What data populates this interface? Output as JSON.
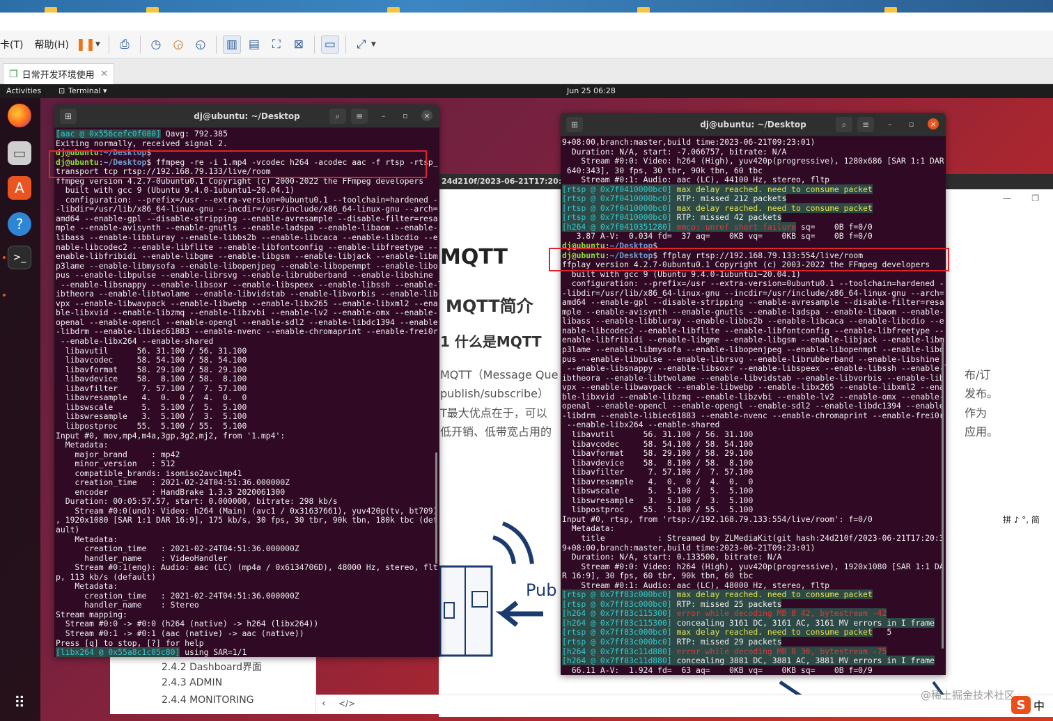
{
  "host": {
    "menu": [
      "卡(T)",
      "帮助(H)"
    ],
    "toolbar_icons": [
      "pause-icon",
      "send-keys-icon",
      "snapshot-icon",
      "revert-icon",
      "manage-snapshots-icon",
      "sidebar-icon",
      "thumbnail-icon",
      "fullscreen-icon",
      "unity-icon",
      "console-icon",
      "stretch-icon"
    ],
    "tab_label": "日常开发环境使用",
    "tab_close": "✕"
  },
  "gnome": {
    "activities": "Activities",
    "app": "Terminal ▾",
    "clock": "Jun 25  06:28"
  },
  "doc": {
    "bar_text": "24d210f/2023-06-21T17:20:39+08:",
    "h1": "MQTT",
    "h2": "MQTT简介",
    "h3": "1 什么是MQTT",
    "p1": "MQTT（Message Que",
    "p2": "publish/subscribe）",
    "p3": "T最大优点在于，可以",
    "p4": "低开销、低带宽占用的",
    "r1": "布/订",
    "r2": "发布。",
    "r3": "作为",
    "r4": "应用。",
    "diagram_label": "Pub",
    "toc": [
      "2.4.2 Dashboard界面",
      "2.4.3 ADMIN",
      "2.4.4 MONITORING"
    ]
  },
  "term_left": {
    "title": "dj@ubuntu: ~/Desktop",
    "lines": [
      [
        {
          "t": "[aac @ 0x556cefc0f080]",
          "c": "cy hl"
        },
        {
          "t": " Qavg: 792.385"
        }
      ],
      [
        {
          "t": "Exiting normally, received signal 2."
        }
      ],
      [
        {
          "t": "dj@ubuntu",
          "c": "gr"
        },
        {
          "t": ":"
        },
        {
          "t": "~/Desktop",
          "c": "bl"
        },
        {
          "t": "$"
        }
      ],
      [
        {
          "t": "dj@ubuntu",
          "c": "gr"
        },
        {
          "t": ":"
        },
        {
          "t": "~/Desktop",
          "c": "bl"
        },
        {
          "t": "$ ffmpeg -re -i 1.mp4 -vcodec h264 -acodec aac -f rtsp -rtsp_"
        }
      ],
      [
        {
          "t": "transport tcp rtsp://192.168.79.133/live/room"
        }
      ],
      [
        {
          "t": "ffmpeg version 4.2.7-0ubuntu0.1 Copyright (c) 2000-2022 the FFmpeg developers"
        }
      ],
      [
        {
          "t": "  built with gcc 9 (Ubuntu 9.4.0-1ubuntu1~20.04.1)"
        }
      ],
      [
        {
          "t": "  configuration: --prefix=/usr --extra-version=0ubuntu0.1 --toolchain=hardened -"
        }
      ],
      [
        {
          "t": "-libdir=/usr/lib/x86_64-linux-gnu --incdir=/usr/include/x86_64-linux-gnu --arch="
        }
      ],
      [
        {
          "t": "amd64 --enable-gpl --disable-stripping --enable-avresample --disable-filter=resa"
        }
      ],
      [
        {
          "t": "mple --enable-avisynth --enable-gnutls --enable-ladspa --enable-libaom --enable-"
        }
      ],
      [
        {
          "t": "libass --enable-libbluray --enable-libbs2b --enable-libcaca --enable-libcdio --e"
        }
      ],
      [
        {
          "t": "nable-libcodec2 --enable-libflite --enable-libfontconfig --enable-libfreetype --"
        }
      ],
      [
        {
          "t": "enable-libfribidi --enable-libgme --enable-libgsm --enable-libjack --enable-libm"
        }
      ],
      [
        {
          "t": "p3lame --enable-libmysofa --enable-libopenjpeg --enable-libopenmpt --enable-libo"
        }
      ],
      [
        {
          "t": "pus --enable-libpulse --enable-librsvg --enable-librubberband --enable-libshine"
        }
      ],
      [
        {
          "t": " --enable-libsnappy --enable-libsoxr --enable-libspeex --enable-libssh --enable-l"
        }
      ],
      [
        {
          "t": "ibtheora --enable-libtwolame --enable-libvidstab --enable-libvorbis --enable-lib"
        }
      ],
      [
        {
          "t": "vpx --enable-libwavpack --enable-libwebp --enable-libx265 --enable-libxml2 --ena"
        }
      ],
      [
        {
          "t": "ble-libxvid --enable-libzmq --enable-libzvbi --enable-lv2 --enable-omx --enable-"
        }
      ],
      [
        {
          "t": "openal --enable-opencl --enable-opengl --enable-sdl2 --enable-libdc1394 --enable"
        }
      ],
      [
        {
          "t": "-libdrm --enable-libiec61883 --enable-nvenc --enable-chromaprint --enable-frei0r"
        }
      ],
      [
        {
          "t": " --enable-libx264 --enable-shared"
        }
      ],
      [
        {
          "t": "  libavutil      56. 31.100 / 56. 31.100"
        }
      ],
      [
        {
          "t": "  libavcodec     58. 54.100 / 58. 54.100"
        }
      ],
      [
        {
          "t": "  libavformat    58. 29.100 / 58. 29.100"
        }
      ],
      [
        {
          "t": "  libavdevice    58.  8.100 / 58.  8.100"
        }
      ],
      [
        {
          "t": "  libavfilter     7. 57.100 /  7. 57.100"
        }
      ],
      [
        {
          "t": "  libavresample   4.  0.  0 /  4.  0.  0"
        }
      ],
      [
        {
          "t": "  libswscale      5.  5.100 /  5.  5.100"
        }
      ],
      [
        {
          "t": "  libswresample   3.  5.100 /  3.  5.100"
        }
      ],
      [
        {
          "t": "  libpostproc    55.  5.100 / 55.  5.100"
        }
      ],
      [
        {
          "t": "Input #0, mov,mp4,m4a,3gp,3g2,mj2, from '1.mp4':"
        }
      ],
      [
        {
          "t": "  Metadata:"
        }
      ],
      [
        {
          "t": "    major_brand     : mp42"
        }
      ],
      [
        {
          "t": "    minor_version   : 512"
        }
      ],
      [
        {
          "t": "    compatible_brands: isomiso2avc1mp41"
        }
      ],
      [
        {
          "t": "    creation_time   : 2021-02-24T04:51:36.000000Z"
        }
      ],
      [
        {
          "t": "    encoder         : HandBrake 1.3.3 2020061300"
        }
      ],
      [
        {
          "t": "  Duration: 00:05:57.57, start: 0.000000, bitrate: 298 kb/s"
        }
      ],
      [
        {
          "t": "    Stream #0:0(und): Video: h264 (Main) (avc1 / 0x31637661), yuv420p(tv, bt709)"
        }
      ],
      [
        {
          "t": ", 1920x1080 [SAR 1:1 DAR 16:9], 175 kb/s, 30 fps, 30 tbr, 90k tbn, 180k tbc (def"
        }
      ],
      [
        {
          "t": "ault)"
        }
      ],
      [
        {
          "t": "    Metadata:"
        }
      ],
      [
        {
          "t": "      creation_time   : 2021-02-24T04:51:36.000000Z"
        }
      ],
      [
        {
          "t": "      handler_name    : VideoHandler"
        }
      ],
      [
        {
          "t": "    Stream #0:1(eng): Audio: aac (LC) (mp4a / 0x6134706D), 48000 Hz, stereo, flt"
        }
      ],
      [
        {
          "t": "p, 113 kb/s (default)"
        }
      ],
      [
        {
          "t": "    Metadata:"
        }
      ],
      [
        {
          "t": "      creation_time   : 2021-02-24T04:51:36.000000Z"
        }
      ],
      [
        {
          "t": "      handler_name    : Stereo"
        }
      ],
      [
        {
          "t": "Stream mapping:"
        }
      ],
      [
        {
          "t": "  Stream #0:0 -> #0:0 (h264 (native) -> h264 (libx264))"
        }
      ],
      [
        {
          "t": "  Stream #0:1 -> #0:1 (aac (native) -> aac (native))"
        }
      ],
      [
        {
          "t": "Press [q] to stop, [?] for help"
        }
      ],
      [
        {
          "t": "[libx264 @ 0x55a8c1c05c80]",
          "c": "cy hl"
        },
        {
          "t": " using SAR=1/1"
        }
      ]
    ]
  },
  "term_right": {
    "title": "dj@ubuntu: ~/Desktop",
    "lines": [
      [
        {
          "t": "9+08:00,branch:master,build time:2023-06-21T09:23:01)"
        }
      ],
      [
        {
          "t": "  Duration: N/A, start: -7.066757, bitrate: N/A"
        }
      ],
      [
        {
          "t": "    Stream #0:0: Video: h264 (High), yuv420p(progressive), 1280x686 [SAR 1:1 DAR"
        }
      ],
      [
        {
          "t": " 640:343], 30 fps, 30 tbr, 90k tbn, 60 tbc"
        }
      ],
      [
        {
          "t": "    Stream #0:1: Audio: aac (LC), 44100 Hz, stereo, fltp"
        }
      ],
      [
        {
          "t": "[rtsp @ 0x7f0410000bc0]",
          "c": "cy hl"
        },
        {
          "t": " max delay reached. need to consume packet",
          "c": "yl hl"
        }
      ],
      [
        {
          "t": "[rtsp @ 0x7f0410000bc0]",
          "c": "cy hl"
        },
        {
          "t": " RTP: missed 212 packets",
          "c": "hl"
        }
      ],
      [
        {
          "t": "[rtsp @ 0x7f0410000bc0]",
          "c": "cy hl"
        },
        {
          "t": " max delay reached. need to consume packet",
          "c": "yl hl"
        }
      ],
      [
        {
          "t": "[rtsp @ 0x7f0410000bc0]",
          "c": "cy hl"
        },
        {
          "t": " RTP: missed 42 packets",
          "c": "hl"
        }
      ],
      [
        {
          "t": "[h264 @ 0x7f0410351280]",
          "c": "cy hl"
        },
        {
          "t": " mmco: unref short failure",
          "c": "rd hl"
        },
        {
          "t": " sq=    0B f=0/0"
        }
      ],
      [
        {
          "t": "   3.87 A-V:  0.034 fd=  37 aq=    0KB vq=    0KB sq=    0B f=0/0"
        }
      ],
      [
        {
          "t": "dj@ubuntu",
          "c": "gr"
        },
        {
          "t": ":"
        },
        {
          "t": "~/Desktop",
          "c": "bl"
        },
        {
          "t": "$"
        }
      ],
      [
        {
          "t": "dj@ubuntu",
          "c": "gr"
        },
        {
          "t": ":"
        },
        {
          "t": "~/Desktop",
          "c": "bl"
        },
        {
          "t": "$ ffplay rtsp://192.168.79.133:554/live/room"
        }
      ],
      [
        {
          "t": "ffplay version 4.2.7-0ubuntu0.1 Copyright (c) 2003-2022 the FFmpeg developers"
        }
      ],
      [
        {
          "t": "  built with gcc 9 (Ubuntu 9.4.0-1ubuntu1~20.04.1)"
        }
      ],
      [
        {
          "t": "  configuration: --prefix=/usr --extra-version=0ubuntu0.1 --toolchain=hardened -"
        }
      ],
      [
        {
          "t": "-libdir=/usr/lib/x86_64-linux-gnu --incdir=/usr/include/x86_64-linux-gnu --arch="
        }
      ],
      [
        {
          "t": "amd64 --enable-gpl --disable-stripping --enable-avresample --disable-filter=resa"
        }
      ],
      [
        {
          "t": "mple --enable-avisynth --enable-gnutls --enable-ladspa --enable-libaom --enable-"
        }
      ],
      [
        {
          "t": "libass --enable-libbluray --enable-libbs2b --enable-libcaca --enable-libcdio --e"
        }
      ],
      [
        {
          "t": "nable-libcodec2 --enable-libflite --enable-libfontconfig --enable-libfreetype --"
        }
      ],
      [
        {
          "t": "enable-libfribidi --enable-libgme --enable-libgsm --enable-libjack --enable-libm"
        }
      ],
      [
        {
          "t": "p3lame --enable-libmysofa --enable-libopenjpeg --enable-libopenmpt --enable-libo"
        }
      ],
      [
        {
          "t": "pus --enable-libpulse --enable-librsvg --enable-librubberband --enable-libshine"
        }
      ],
      [
        {
          "t": " --enable-libsnappy --enable-libsoxr --enable-libspeex --enable-libssh --enable-l"
        }
      ],
      [
        {
          "t": "ibtheora --enable-libtwolame --enable-libvidstab --enable-libvorbis --enable-lib"
        }
      ],
      [
        {
          "t": "vpx --enable-libwavpack --enable-libwebp --enable-libx265 --enable-libxml2 --ena"
        }
      ],
      [
        {
          "t": "ble-libxvid --enable-libzmq --enable-libzvbi --enable-lv2 --enable-omx --enable-"
        }
      ],
      [
        {
          "t": "openal --enable-opencl --enable-opengl --enable-sdl2 --enable-libdc1394 --enable"
        }
      ],
      [
        {
          "t": "-libdrm --enable-libiec61883 --enable-nvenc --enable-chromaprint --enable-frei0r"
        }
      ],
      [
        {
          "t": " --enable-libx264 --enable-shared"
        }
      ],
      [
        {
          "t": "  libavutil      56. 31.100 / 56. 31.100"
        }
      ],
      [
        {
          "t": "  libavcodec     58. 54.100 / 58. 54.100"
        }
      ],
      [
        {
          "t": "  libavformat    58. 29.100 / 58. 29.100"
        }
      ],
      [
        {
          "t": "  libavdevice    58.  8.100 / 58.  8.100"
        }
      ],
      [
        {
          "t": "  libavfilter     7. 57.100 /  7. 57.100"
        }
      ],
      [
        {
          "t": "  libavresample   4.  0.  0 /  4.  0.  0"
        }
      ],
      [
        {
          "t": "  libswscale      5.  5.100 /  5.  5.100"
        }
      ],
      [
        {
          "t": "  libswresample   3.  5.100 /  3.  5.100"
        }
      ],
      [
        {
          "t": "  libpostproc    55.  5.100 / 55.  5.100"
        }
      ],
      [
        {
          "t": "Input #0, rtsp, from 'rtsp://192.168.79.133:554/live/room': f=0/0"
        }
      ],
      [
        {
          "t": "  Metadata:"
        }
      ],
      [
        {
          "t": "    title           : Streamed by ZLMediaKit(git hash:24d210f/2023-06-21T17:20:3"
        }
      ],
      [
        {
          "t": "9+08:00,branch:master,build time:2023-06-21T09:23:01)"
        }
      ],
      [
        {
          "t": "  Duration: N/A, start: 0.133500, bitrate: N/A"
        }
      ],
      [
        {
          "t": "    Stream #0:0: Video: h264 (High), yuv420p(progressive), 1920x1080 [SAR 1:1 DA"
        }
      ],
      [
        {
          "t": "R 16:9], 30 fps, 60 tbr, 90k tbn, 60 tbc"
        }
      ],
      [
        {
          "t": "    Stream #0:1: Audio: aac (LC), 48000 Hz, stereo, fltp"
        }
      ],
      [
        {
          "t": "[rtsp @ 0x7ff83c000bc0]",
          "c": "cy hl"
        },
        {
          "t": " max delay reached. need to consume packet",
          "c": "yl hl"
        }
      ],
      [
        {
          "t": "[rtsp @ 0x7ff83c000bc0]",
          "c": "cy hl"
        },
        {
          "t": " RTP: missed 25 packets",
          "c": "hl"
        }
      ],
      [
        {
          "t": "[h264 @ 0x7ff83c115300]",
          "c": "cy hl"
        },
        {
          "t": " error while decoding MB 8 42, bytestream -42",
          "c": "rd hl"
        }
      ],
      [
        {
          "t": "[h264 @ 0x7ff83c115300]",
          "c": "cy hl"
        },
        {
          "t": " concealing 3161 DC, 3161 AC, 3161 MV errors in I frame",
          "c": "hl"
        }
      ],
      [
        {
          "t": "[rtsp @ 0x7ff83c000bc0]",
          "c": "cy hl"
        },
        {
          "t": " max delay reached. need to consume packet",
          "c": "yl hl"
        },
        {
          "t": "   5"
        }
      ],
      [
        {
          "t": "[rtsp @ 0x7ff83c000bc0]",
          "c": "cy hl"
        },
        {
          "t": " RTP: missed 29 packets",
          "c": "hl"
        }
      ],
      [
        {
          "t": "[h264 @ 0x7ff83c11d880]",
          "c": "cy hl"
        },
        {
          "t": " error while decoding MB 8 36, bytestream -75",
          "c": "rd hl"
        }
      ],
      [
        {
          "t": "[h264 @ 0x7ff83c11d880]",
          "c": "cy hl"
        },
        {
          "t": " concealing 3881 DC, 3881 AC, 3881 MV errors in I frame",
          "c": "hl"
        }
      ],
      [
        {
          "t": "  66.11 A-V:  1.924 fd=  63 aq=    0KB vq=    0KB sq=    0B f=0/9"
        }
      ]
    ]
  },
  "watermark": "@稀土掘金技术社区",
  "ime": {
    "label": "中",
    "tray": "拼 ♪ °, 简"
  }
}
